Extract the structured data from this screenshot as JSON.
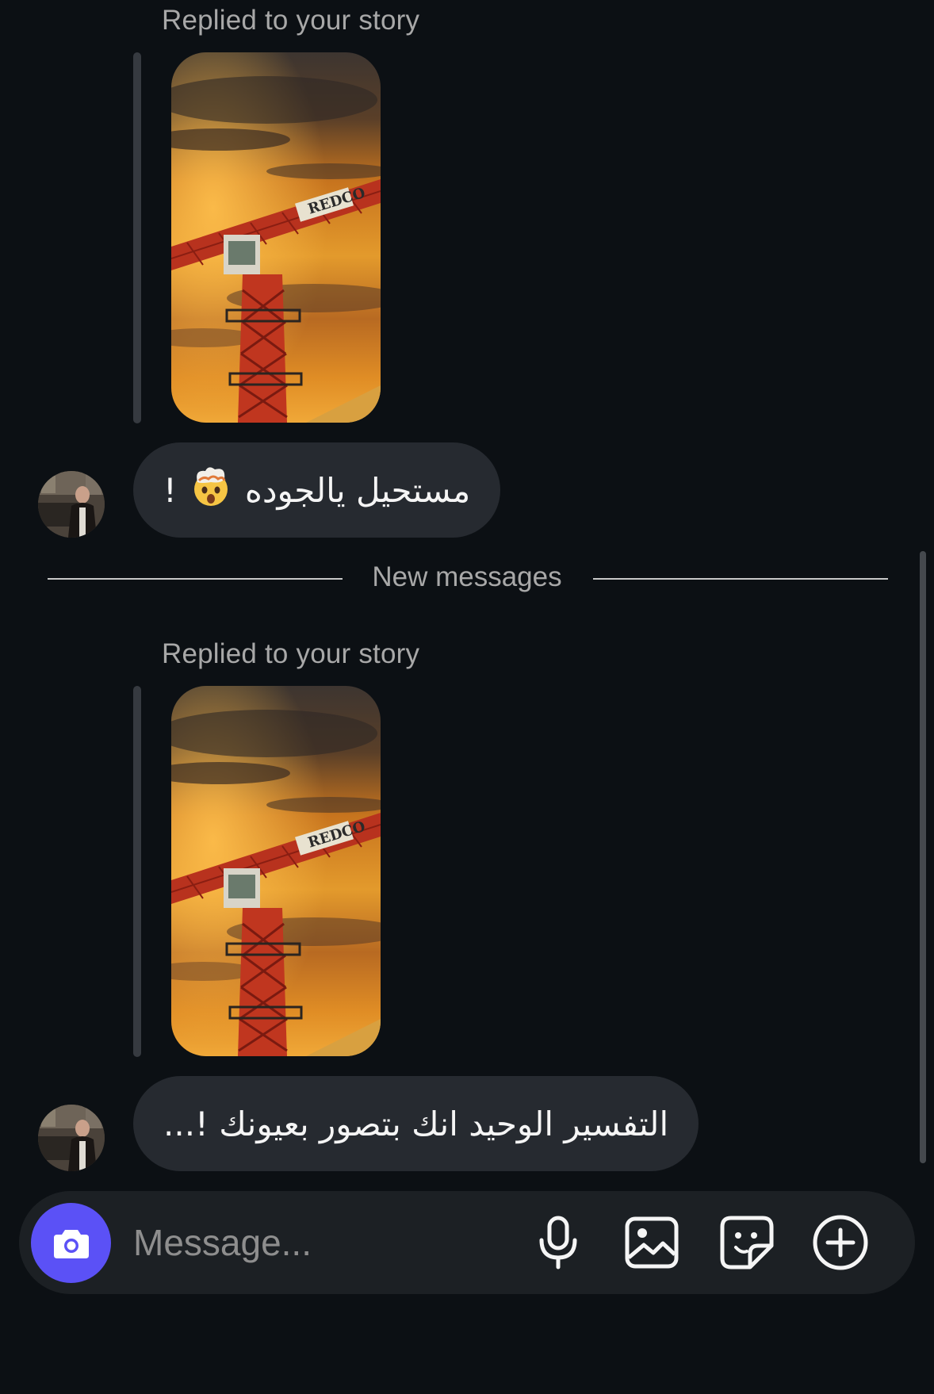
{
  "thread": {
    "messages": [
      {
        "reply_label": "Replied to your story",
        "story_text": "REDCO",
        "text": "مستحيل يالجوده",
        "emoji": "🤯",
        "suffix": "!"
      },
      {
        "reply_label": "Replied to your story",
        "story_text": "REDCO",
        "text": "التفسير الوحيد انك بتصور بعيونك !..."
      }
    ],
    "divider_label": "New messages"
  },
  "composer": {
    "placeholder": "Message...",
    "icons": [
      "camera-icon",
      "microphone-icon",
      "gallery-icon",
      "sticker-icon",
      "add-icon"
    ],
    "accent_color": "#5b51f6"
  }
}
